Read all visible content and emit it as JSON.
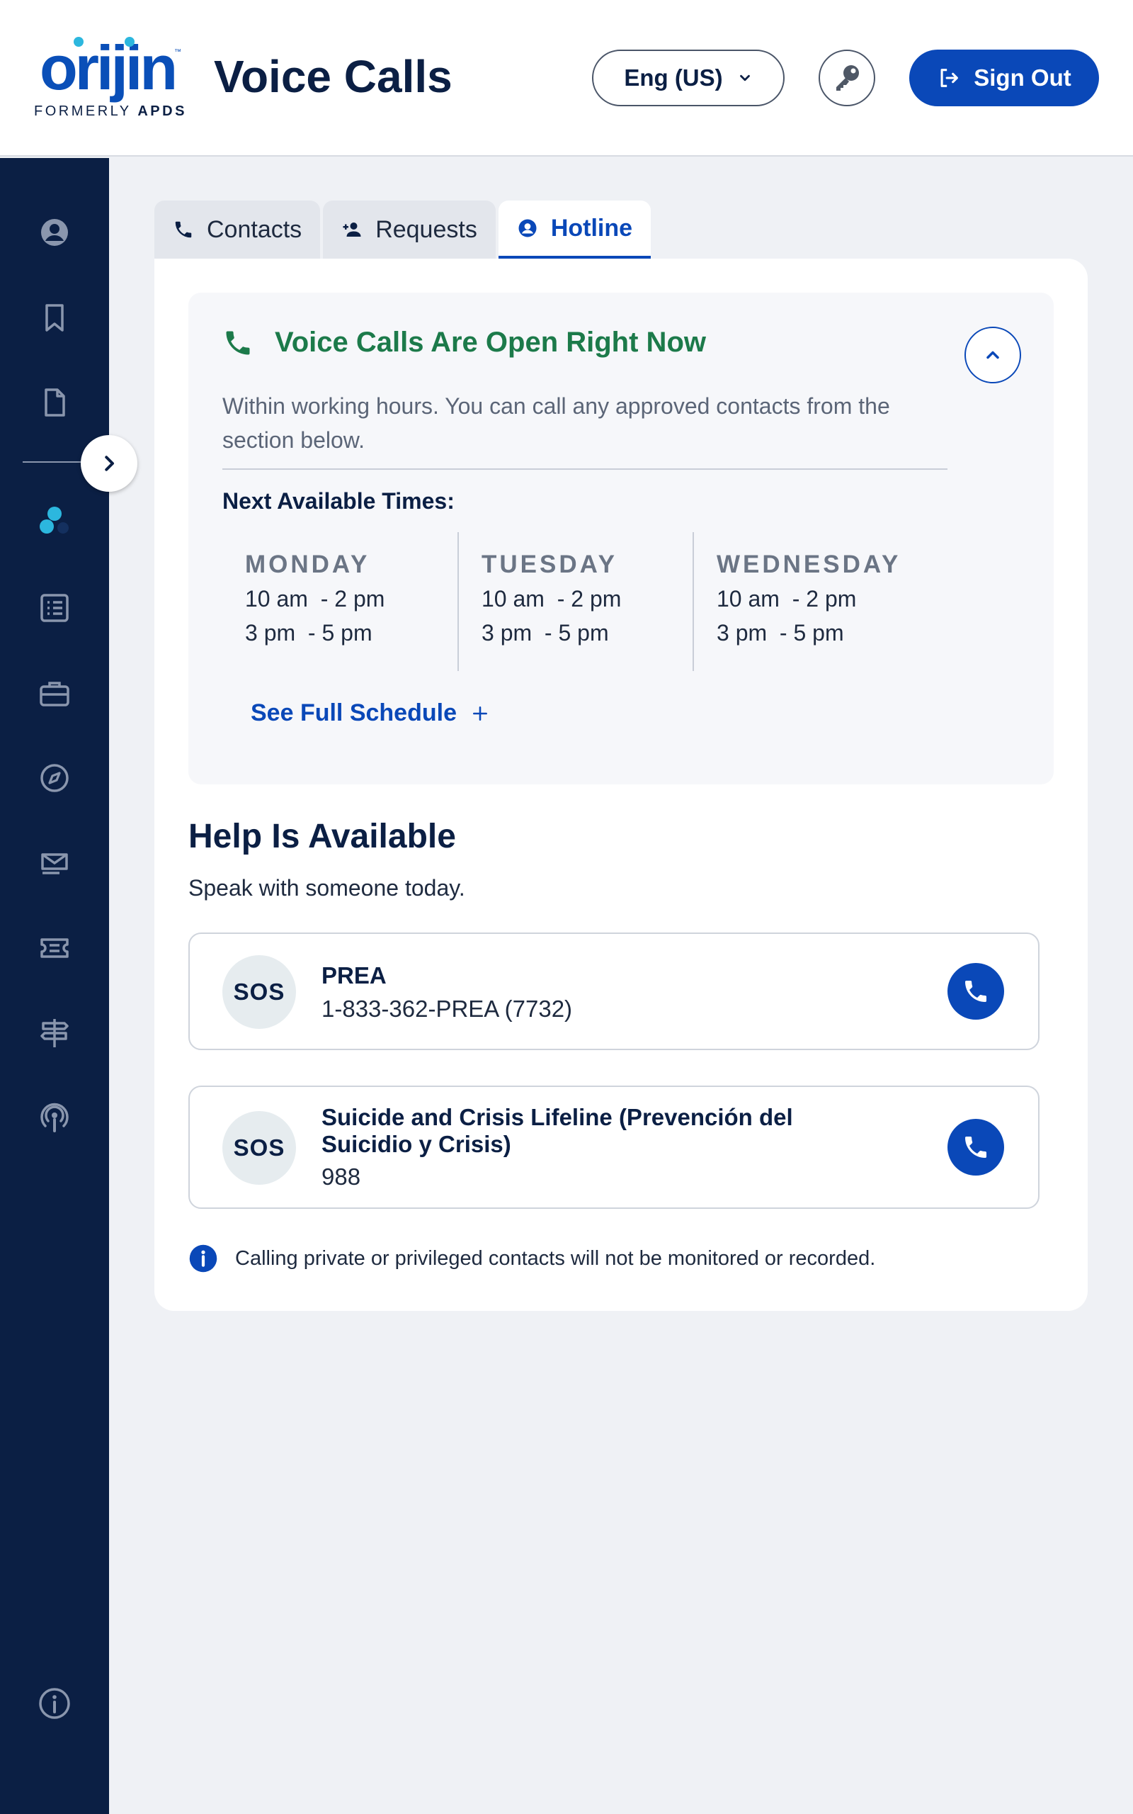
{
  "header": {
    "logo_text": "orijin",
    "logo_tm": "™",
    "logo_sub_prefix": "FORMERLY ",
    "logo_sub_brand": "APDS",
    "title": "Voice Calls",
    "language_label": "Eng (US)",
    "sign_out_label": "Sign Out",
    "icons": {
      "language": "chevron-down-icon",
      "key": "key-icon",
      "sign_out": "sign-out-icon"
    }
  },
  "sidebar": {
    "items": [
      {
        "icon": "user-circle-icon"
      },
      {
        "icon": "bookmark-icon"
      },
      {
        "icon": "document-icon"
      },
      {
        "icon": "messaging-dots-icon"
      },
      {
        "icon": "list-icon"
      },
      {
        "icon": "briefcase-icon"
      },
      {
        "icon": "compass-icon"
      },
      {
        "icon": "mail-icon"
      },
      {
        "icon": "ticket-icon"
      },
      {
        "icon": "signpost-icon"
      },
      {
        "icon": "podcast-icon"
      },
      {
        "icon": "info-icon"
      }
    ],
    "expand_icon": "chevron-right-icon",
    "colors": {
      "background": "#0b1f44",
      "icon": "#8a96ad",
      "accent": "#2cb7de"
    }
  },
  "tabs": [
    {
      "label": "Contacts",
      "icon": "phone-icon",
      "active": false
    },
    {
      "label": "Requests",
      "icon": "add-user-icon",
      "active": false
    },
    {
      "label": "Hotline",
      "icon": "user-circle-icon",
      "active": true
    }
  ],
  "status": {
    "title": "Voice Calls Are Open Right Now",
    "description": "Within working hours. You can call any approved contacts from the section below.",
    "next_label": "Next Available Times:",
    "days": [
      {
        "name": "MONDAY",
        "slots": [
          "10 am  - 2 pm",
          "3 pm  - 5 pm"
        ]
      },
      {
        "name": "TUESDAY",
        "slots": [
          "10 am  - 2 pm",
          "3 pm  - 5 pm"
        ]
      },
      {
        "name": "WEDNESDAY",
        "slots": [
          "10 am  - 2 pm",
          "3 pm  - 5 pm"
        ]
      }
    ],
    "schedule_link": "See Full Schedule",
    "colors": {
      "open": "#1c7a4a"
    }
  },
  "help": {
    "title": "Help Is Available",
    "subtitle": "Speak with someone today.",
    "hotlines": [
      {
        "badge": "SOS",
        "name": "PREA",
        "number": "1-833-362-PREA (7732)"
      },
      {
        "badge": "SOS",
        "name": "Suicide and Crisis Lifeline (Prevención del Suicidio y Crisis)",
        "number": "988"
      }
    ],
    "privacy_note": "Calling private or privileged contacts will not be monitored or recorded."
  },
  "colors": {
    "primary": "#0a48b8",
    "navy": "#0b1f44",
    "page_bg": "#eff1f5"
  }
}
